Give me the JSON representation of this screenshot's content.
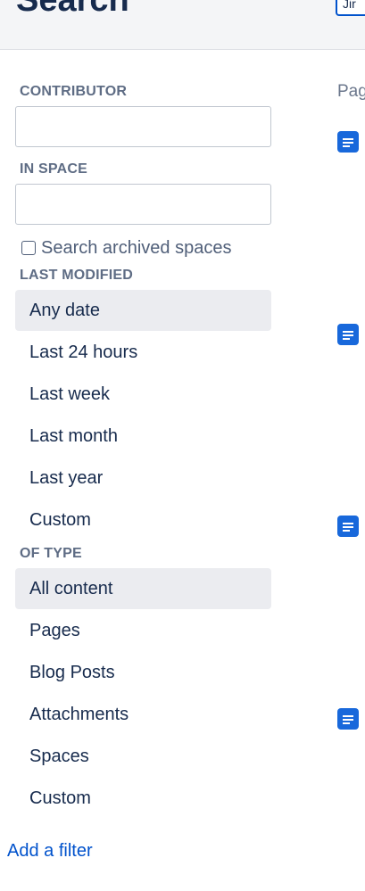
{
  "header": {
    "title": "Search",
    "search_input_value": "Jir"
  },
  "filters": {
    "contributor_label": "CONTRIBUTOR",
    "contributor_value": "",
    "in_space_label": "IN SPACE",
    "in_space_value": "",
    "archived_checkbox_label": "Search archived spaces",
    "archived_checked": false,
    "last_modified_label": "LAST MODIFIED",
    "last_modified_options": [
      "Any date",
      "Last 24 hours",
      "Last week",
      "Last month",
      "Last year",
      "Custom"
    ],
    "last_modified_selected": "Any date",
    "of_type_label": "OF TYPE",
    "of_type_options": [
      "All content",
      "Pages",
      "Blog Posts",
      "Attachments",
      "Spaces",
      "Custom"
    ],
    "of_type_selected": "All content",
    "add_filter_label": "Add a filter"
  },
  "results": {
    "heading": "Pag",
    "items": [
      {
        "icon": "page-icon"
      },
      {
        "icon": "page-icon"
      },
      {
        "icon": "page-icon"
      },
      {
        "icon": "page-icon"
      }
    ]
  },
  "colors": {
    "link": "#0052cc",
    "selected_bg": "#ebecf0",
    "label": "#5e6c84",
    "icon_blue": "#1868db"
  }
}
